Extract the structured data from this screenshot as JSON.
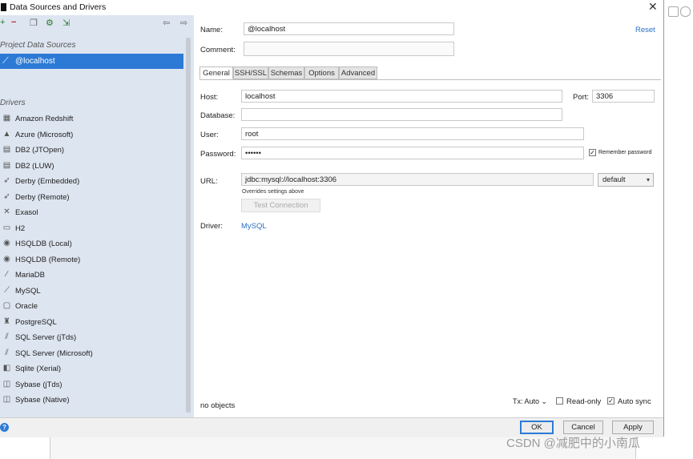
{
  "window": {
    "title": "Data Sources and Drivers",
    "close_glyph": "✕"
  },
  "left": {
    "toolbar": [
      {
        "glyph": "+",
        "icon": "add-icon"
      },
      {
        "glyph": "−",
        "icon": "remove-icon"
      },
      {
        "glyph": "❐",
        "icon": "duplicate-icon"
      },
      {
        "glyph": "⚙",
        "icon": "settings-icon"
      },
      {
        "glyph": "⇲",
        "icon": "import-icon"
      },
      {
        "glyph": "⇦",
        "icon": "back-icon"
      },
      {
        "glyph": "⇨",
        "icon": "forward-icon"
      }
    ],
    "project_header": "Project Data Sources",
    "selected_source": {
      "label": "@localhost",
      "glyph": "⟋",
      "icon": "mysql-dolphin-icon"
    },
    "drivers_header": "Drivers",
    "drivers": [
      {
        "label": "Amazon Redshift",
        "glyph": "▦",
        "icon": "redshift-icon"
      },
      {
        "label": "Azure (Microsoft)",
        "glyph": "▲",
        "icon": "azure-icon"
      },
      {
        "label": "DB2 (JTOpen)",
        "glyph": "▤",
        "icon": "db2-icon"
      },
      {
        "label": "DB2 (LUW)",
        "glyph": "▤",
        "icon": "db2-icon"
      },
      {
        "label": "Derby (Embedded)",
        "glyph": "➶",
        "icon": "derby-icon"
      },
      {
        "label": "Derby (Remote)",
        "glyph": "➶",
        "icon": "derby-icon"
      },
      {
        "label": "Exasol",
        "glyph": "✕",
        "icon": "exasol-icon"
      },
      {
        "label": "H2",
        "glyph": "▭",
        "icon": "h2-icon"
      },
      {
        "label": "HSQLDB (Local)",
        "glyph": "◉",
        "icon": "hsqldb-icon"
      },
      {
        "label": "HSQLDB (Remote)",
        "glyph": "◉",
        "icon": "hsqldb-icon"
      },
      {
        "label": "MariaDB",
        "glyph": "∕",
        "icon": "mariadb-icon"
      },
      {
        "label": "MySQL",
        "glyph": "⟋",
        "icon": "mysql-icon"
      },
      {
        "label": "Oracle",
        "glyph": "▢",
        "icon": "oracle-icon"
      },
      {
        "label": "PostgreSQL",
        "glyph": "♜",
        "icon": "postgresql-icon"
      },
      {
        "label": "SQL Server (jTds)",
        "glyph": "⫽",
        "icon": "sqlserver-icon"
      },
      {
        "label": "SQL Server (Microsoft)",
        "glyph": "⫽",
        "icon": "sqlserver-icon"
      },
      {
        "label": "Sqlite (Xerial)",
        "glyph": "◧",
        "icon": "sqlite-icon"
      },
      {
        "label": "Sybase (jTds)",
        "glyph": "◫",
        "icon": "sybase-icon"
      },
      {
        "label": "Sybase (Native)",
        "glyph": "◫",
        "icon": "sybase-icon"
      }
    ]
  },
  "form": {
    "name_label": "Name:",
    "name_value": "@localhost",
    "reset_label": "Reset",
    "comment_label": "Comment:",
    "comment_value": "",
    "tabs": [
      "General",
      "SSH/SSL",
      "Schemas",
      "Options",
      "Advanced"
    ],
    "host_label": "Host:",
    "host_value": "localhost",
    "port_label": "Port:",
    "port_value": "3306",
    "database_label": "Database:",
    "database_value": "",
    "user_label": "User:",
    "user_value": "root",
    "password_label": "Password:",
    "password_value": "••••••",
    "remember_label": "Remember password",
    "remember_checked": "✓",
    "url_label": "URL:",
    "url_value": "jdbc:mysql://localhost:3306",
    "url_hint": "Overrides settings above",
    "url_mode": "default",
    "test_connection": "Test Connection",
    "driver_label": "Driver:",
    "driver_value": "MySQL"
  },
  "status": {
    "objects": "no objects",
    "tx": "Tx: Auto",
    "readonly_label": "Read-only",
    "readonly_checked": "",
    "autosync_label": "Auto sync",
    "autosync_checked": "✓"
  },
  "footer": {
    "help": "?",
    "ok": "OK",
    "cancel": "Cancel",
    "apply": "Apply"
  },
  "watermark": "CSDN @减肥中的小南瓜"
}
